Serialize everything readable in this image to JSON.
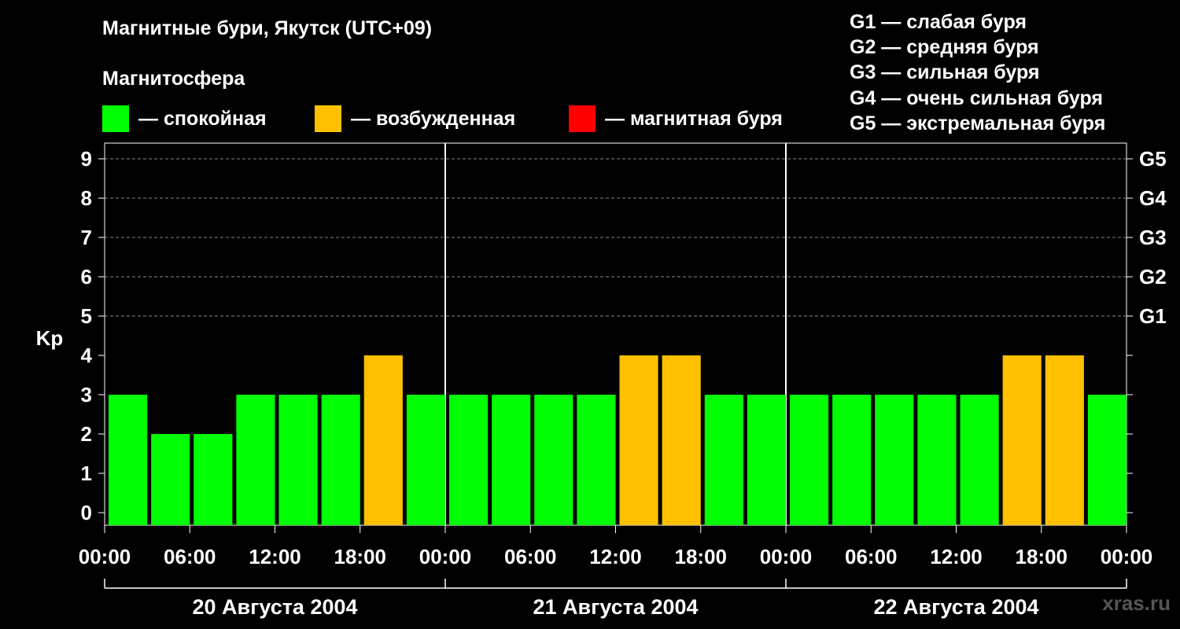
{
  "title": "Магнитные бури, Якутск (UTC+09)",
  "subtitle": "Магнитосфера",
  "legend": [
    {
      "color": "#00ff00",
      "label": "— спокойная"
    },
    {
      "color": "#ffc000",
      "label": "— возбужденная"
    },
    {
      "color": "#ff0000",
      "label": "— магнитная буря"
    }
  ],
  "g_scale": [
    "G1 — слабая буря",
    "G2 — средняя буря",
    "G3 — сильная буря",
    "G4 — очень сильная буря",
    "G5 — экстремальная буря"
  ],
  "watermark": "xras.ru",
  "chart_data": {
    "type": "bar",
    "ylabel": "Kp",
    "ylim": [
      0,
      9
    ],
    "y_ticks": [
      "0",
      "1",
      "2",
      "3",
      "4",
      "5",
      "6",
      "7",
      "8",
      "9"
    ],
    "right_labels": [
      {
        "kp": 5,
        "label": "G1"
      },
      {
        "kp": 6,
        "label": "G2"
      },
      {
        "kp": 7,
        "label": "G3"
      },
      {
        "kp": 8,
        "label": "G4"
      },
      {
        "kp": 9,
        "label": "G5"
      }
    ],
    "x_tick_labels": [
      "00:00",
      "06:00",
      "12:00",
      "18:00",
      "00:00",
      "06:00",
      "12:00",
      "18:00",
      "00:00",
      "06:00",
      "12:00",
      "18:00",
      "00:00"
    ],
    "days": [
      "20 Августа 2004",
      "21 Августа 2004",
      "22 Августа 2004"
    ],
    "values": [
      3,
      2,
      2,
      3,
      3,
      3,
      4,
      3,
      3,
      3,
      3,
      3,
      4,
      4,
      3,
      3,
      3,
      3,
      3,
      3,
      3,
      4,
      4,
      3
    ],
    "colors": {
      "quiet": "#00ff00",
      "active": "#ffc000",
      "storm": "#ff0000"
    },
    "grid": "dashed horizontal at Kp 5-9"
  }
}
